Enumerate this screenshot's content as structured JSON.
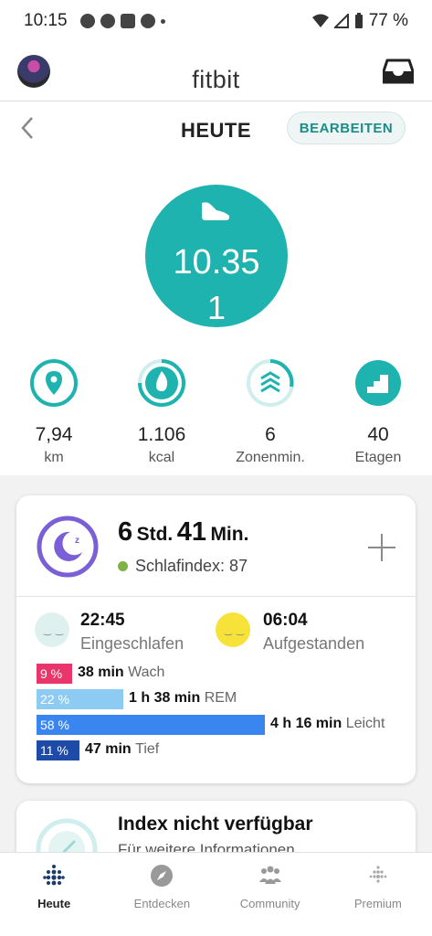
{
  "status_bar": {
    "time": "10:15",
    "battery": "77 %"
  },
  "app": {
    "brand": "fitbit"
  },
  "day_nav": {
    "title": "HEUTE",
    "edit_label": "BEARBEITEN"
  },
  "hero": {
    "icon": "shoe-icon",
    "value_line1": "10.35",
    "value_line2": "1",
    "color": "#1fb3b0"
  },
  "stats": [
    {
      "icon": "location-pin-icon",
      "value": "7,94",
      "unit": "km"
    },
    {
      "icon": "flame-icon",
      "value": "1.106",
      "unit": "kcal"
    },
    {
      "icon": "zone-chevrons-icon",
      "value": "6",
      "unit": "Zonenmin."
    },
    {
      "icon": "stairs-icon",
      "value": "40",
      "unit": "Etagen"
    }
  ],
  "sleep": {
    "hours": "6",
    "hours_unit": "Std.",
    "minutes": "41",
    "minutes_unit": "Min.",
    "score_text": "Schlafindex: 87",
    "fell_asleep_time": "22:45",
    "fell_asleep_label": "Eingeschlafen",
    "woke_time": "06:04",
    "woke_label": "Aufgestanden",
    "stages": [
      {
        "percent": "9 %",
        "duration": "38 min",
        "name": "Wach",
        "fraction": 0.09,
        "color": "#e8356b"
      },
      {
        "percent": "22 %",
        "duration": "1 h 38 min",
        "name": "REM",
        "fraction": 0.22,
        "color": "#8ecbf3"
      },
      {
        "percent": "58 %",
        "duration": "4 h 16 min",
        "name": "Leicht",
        "fraction": 0.58,
        "color": "#3a86f0"
      },
      {
        "percent": "11 %",
        "duration": "47 min",
        "name": "Tief",
        "fraction": 0.11,
        "color": "#1e4aa8"
      }
    ]
  },
  "index_card": {
    "title": "Index nicht verfügbar",
    "subtitle": "Für weitere Informationen"
  },
  "bottom_nav": [
    {
      "label": "Heute",
      "icon": "dots-grid-icon",
      "active": true
    },
    {
      "label": "Entdecken",
      "icon": "compass-icon",
      "active": false
    },
    {
      "label": "Community",
      "icon": "people-icon",
      "active": false
    },
    {
      "label": "Premium",
      "icon": "premium-dots-icon",
      "active": false
    }
  ]
}
